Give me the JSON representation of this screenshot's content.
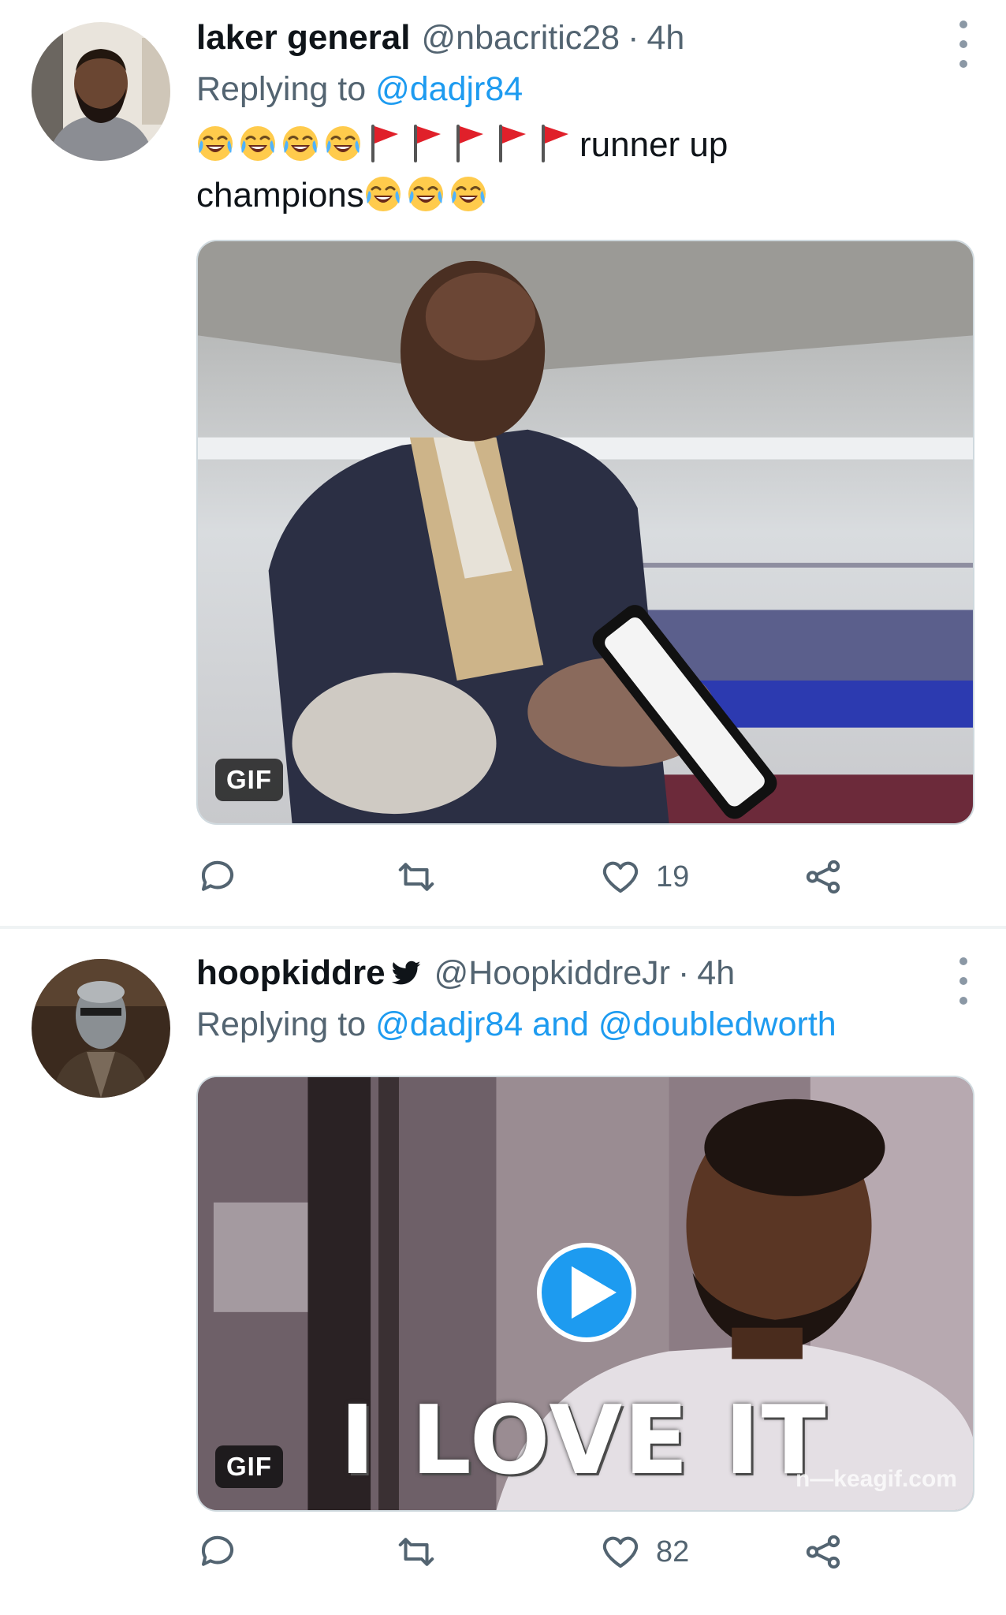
{
  "tweets": [
    {
      "display_name": "laker general",
      "handle": "@nbacritic28",
      "separator": "·",
      "time": "4h",
      "replying_prefix": "Replying to",
      "replying_to": "@dadjr84",
      "text_suffix_line1": "runner up",
      "text_line2_word": "champions",
      "emojis_line1": [
        "face-with-tears-of-joy",
        "face-with-tears-of-joy",
        "face-with-tears-of-joy",
        "face-with-tears-of-joy"
      ],
      "flags_line1": [
        "red-flag",
        "red-flag",
        "red-flag",
        "red-flag",
        "red-flag"
      ],
      "emojis_line2": [
        "face-with-tears-of-joy",
        "face-with-tears-of-joy",
        "face-with-tears-of-joy"
      ],
      "media_badge": "GIF",
      "reply_count": "",
      "retweet_count": "",
      "like_count": "19"
    },
    {
      "display_name": "hoopkiddre",
      "verified_icon": "bird-icon",
      "handle": "@HoopkiddreJr",
      "separator": "·",
      "time": "4h",
      "replying_prefix": "Replying to",
      "replying_to_1": "@dadjr84",
      "replying_joiner": "and",
      "replying_to_2": "@doubledworth",
      "media_badge": "GIF",
      "media_caption": "I LOVE IT",
      "media_watermark": "n—keagif.com",
      "reply_count": "",
      "retweet_count": "",
      "like_count": "82"
    }
  ],
  "colors": {
    "text_primary": "#0f1419",
    "text_secondary": "#536471",
    "link": "#1d9bf0",
    "separator": "#eff3f4"
  }
}
